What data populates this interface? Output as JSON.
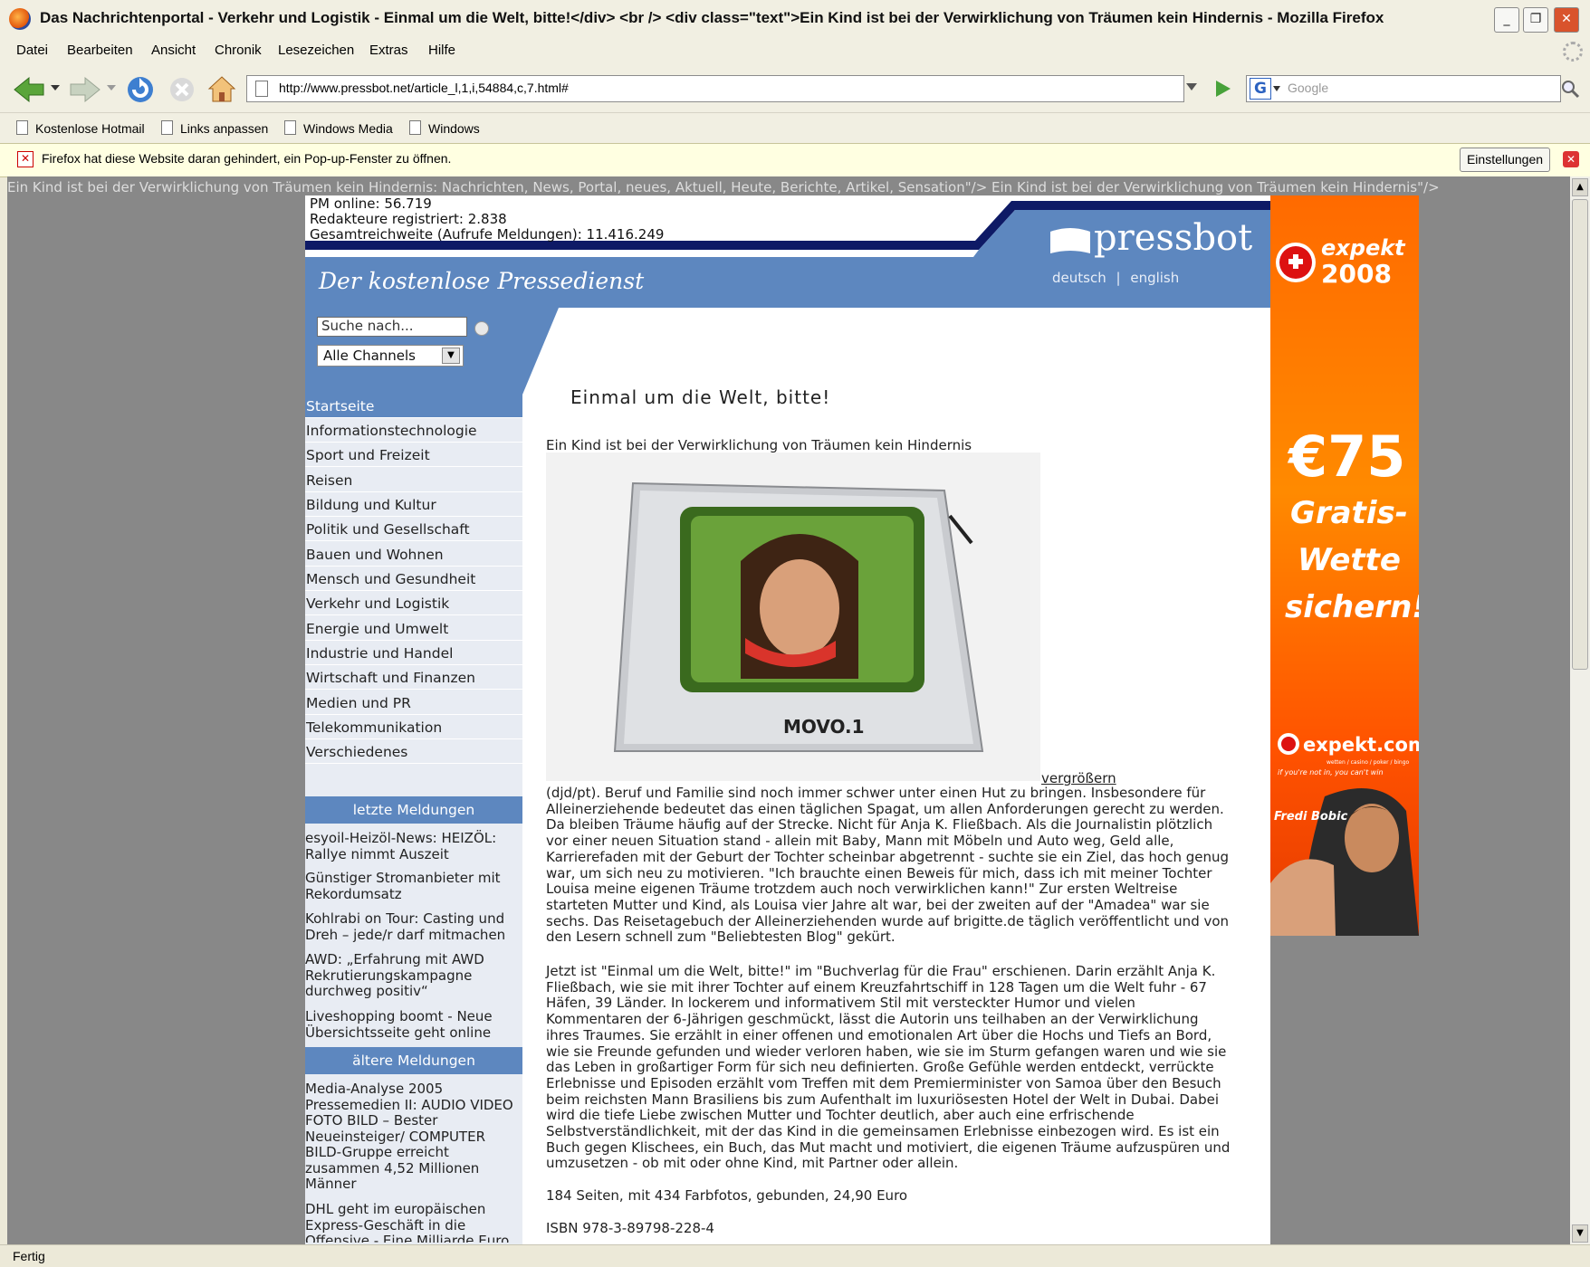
{
  "window": {
    "title": "Das Nachrichtenportal - Verkehr und Logistik - Einmal um die Welt, bitte!</div> <br /> <div class=\"text\">Ein Kind ist bei der Verwirklichung von Träumen kein Hindernis - Mozilla Firefox",
    "minimize": "_",
    "restore": "❐",
    "close": "✕"
  },
  "menu": [
    "Datei",
    "Bearbeiten",
    "Ansicht",
    "Chronik",
    "Lesezeichen",
    "Extras",
    "Hilfe"
  ],
  "toolbar": {
    "url": "http://www.pressbot.net/article_l,1,i,54884,c,7.html#",
    "search_placeholder": "Google",
    "search_engine": "G"
  },
  "bookmarks": [
    "Kostenlose Hotmail",
    "Links anpassen",
    "Windows Media",
    "Windows"
  ],
  "popup": {
    "message": "Firefox hat diese Website daran gehindert, ein Pop-up-Fenster zu öffnen.",
    "settings_label": "Einstellungen"
  },
  "page": {
    "meta_line": "Ein Kind ist bei der Verwirklichung von Träumen kein Hindernis: Nachrichten, News, Portal, neues, Aktuell, Heute, Berichte, Artikel, Sensation\"/> Ein Kind ist bei der Verwirklichung von Träumen kein Hindernis\"/>",
    "stats": [
      "PM online: 56.719",
      "Redakteure registriert: 2.838",
      "Gesamtreichweite (Aufrufe Meldungen): 11.416.249"
    ],
    "slogan": "Der kostenlose Pressedienst",
    "logo": "pressbot",
    "lang_de": "deutsch",
    "lang_sep": "|",
    "lang_en": "english",
    "search_placeholder": "Suche nach...",
    "channel_select": "Alle Channels"
  },
  "sidebar": {
    "nav": [
      "Startseite",
      "Informationstechnologie",
      "Sport und Freizeit",
      "Reisen",
      "Bildung und Kultur",
      "Politik und Gesellschaft",
      "Bauen und Wohnen",
      "Mensch und Gesundheit",
      "Verkehr und Logistik",
      "Energie und Umwelt",
      "Industrie und Handel",
      "Wirtschaft und Finanzen",
      "Medien und PR",
      "Telekommunikation",
      "Verschiedenes"
    ],
    "latest_head": "letzte Meldungen",
    "latest": [
      "esyoil-Heizöl-News: HEIZÖL: Rallye nimmt Auszeit",
      "Günstiger Stromanbieter mit Rekordumsatz",
      "Kohlrabi on Tour: Casting und Dreh – jede/r darf mitmachen",
      "AWD: „Erfahrung mit AWD Rekrutierungskampagne durchweg positiv“",
      "Liveshopping boomt - Neue Übersichtsseite geht online"
    ],
    "older_head": "ältere Meldungen",
    "older": [
      "Media-Analyse 2005 Pressemedien II: AUDIO VIDEO FOTO BILD – Bester Neueinsteiger/ COMPUTER BILD-Gruppe erreicht zusammen 4,52 Millionen Männer",
      "DHL geht im europäischen Express-Geschäft in die Offensive - Eine Milliarde Euro"
    ]
  },
  "article": {
    "title": "Einmal um die Welt, bitte!",
    "subtitle": "Ein Kind ist bei der Verwirklichung von Träumen kein Hindernis",
    "photo_brand": "MOVO.1",
    "enlarge": "vergrößern",
    "p1": "(djd/pt). Beruf und Familie sind noch immer schwer unter einen Hut zu bringen. Insbesondere für Alleinerziehende bedeutet das einen täglichen Spagat, um allen Anforderungen gerecht zu werden. Da bleiben Träume häufig auf der Strecke. Nicht für Anja K. Fließbach. Als die Journalistin plötzlich vor einer neuen Situation stand - allein mit Baby, Mann mit Möbeln und Auto weg, Geld alle, Karrierefaden mit der Geburt der Tochter scheinbar abgetrennt - suchte sie ein Ziel, das hoch genug war, um sich neu zu motivieren. \"Ich brauchte einen Beweis für mich, dass ich mit meiner Tochter Louisa meine eigenen Träume trotzdem auch noch verwirklichen kann!\" Zur ersten Weltreise starteten Mutter und Kind, als Louisa vier Jahre alt war, bei der zweiten auf der \"Amadea\" war sie sechs. Das Reisetagebuch der Alleinerziehenden wurde auf brigitte.de täglich veröffentlicht und von den Lesern schnell zum \"Beliebtesten Blog\" gekürt.",
    "p2": "Jetzt ist \"Einmal um die Welt, bitte!\" im \"Buchverlag für die Frau\" erschienen. Darin erzählt Anja K. Fließbach, wie sie mit ihrer Tochter auf einem Kreuzfahrtschiff in 128 Tagen um die Welt fuhr - 67 Häfen, 39 Länder. In lockerem und informativem Stil mit versteckter Humor und vielen Kommentaren der 6-Jährigen geschmückt, lässt die Autorin uns teilhaben an der Verwirklichung ihres Traumes. Sie erzählt in einer offenen und emotionalen Art über die Hochs und Tiefs an Bord, wie sie Freunde gefunden und wieder verloren haben, wie sie im Sturm gefangen waren und wie sie das Leben in großartiger Form für sich neu definierten. Große Gefühle werden entdeckt, verrückte Erlebnisse und Episoden erzählt vom Treffen mit dem Premierminister von Samoa über den Besuch beim reichsten Mann Brasiliens bis zum Aufenthalt im luxuriösesten Hotel der Welt in Dubai. Dabei wird die tiefe Liebe zwischen Mutter und Tochter deutlich, aber auch eine erfrischende Selbstverständlichkeit, mit der das Kind in die gemeinsamen Erlebnisse einbezogen wird. Es ist ein Buch gegen Klischees, ein Buch, das Mut macht und motiviert, die eigenen Träume aufzuspüren und umzusetzen - ob mit oder ohne Kind, mit Partner oder allein.",
    "p3": "184 Seiten, mit 434 Farbfotos, gebunden, 24,90 Euro",
    "p4": "ISBN 978-3-89798-228-4"
  },
  "ad": {
    "brand_top": "expekt",
    "year": "2008",
    "amount": "€75",
    "line1": "Gratis-",
    "line2": "Wette",
    "line3": "sichern!",
    "brand_bottom": "expekt.com",
    "tagline_small": "wetten / casino / poker / bingo",
    "tagline": "if you're not in, you can't win",
    "person": "Fredi Bobic"
  },
  "status": "Fertig",
  "colors": {
    "site_blue": "#5d87bf",
    "navy": "#0e1a66",
    "ad_orange": "#ff6a00"
  }
}
